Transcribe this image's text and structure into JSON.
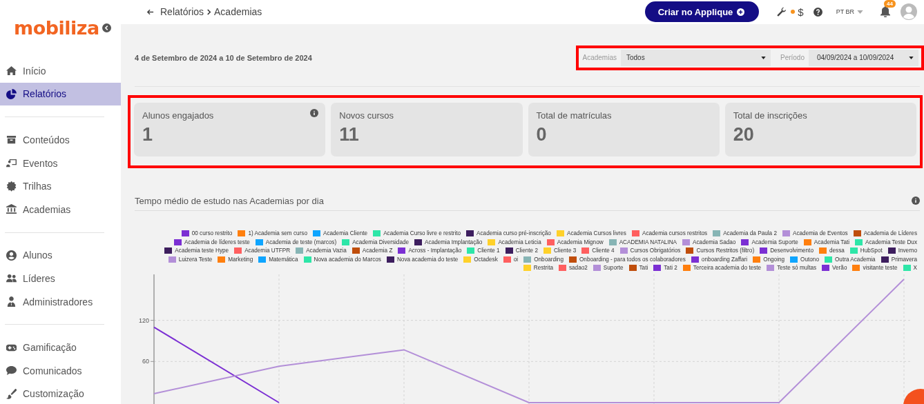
{
  "sidebar": {
    "logo": "mobiliza",
    "groups": [
      {
        "items": [
          {
            "label": "Início",
            "selected": false
          },
          {
            "label": "Relatórios",
            "selected": true
          }
        ]
      },
      {
        "items": [
          {
            "label": "Conteúdos",
            "selected": false
          },
          {
            "label": "Eventos",
            "selected": false
          },
          {
            "label": "Trilhas",
            "selected": false
          },
          {
            "label": "Academias",
            "selected": false
          }
        ]
      },
      {
        "items": [
          {
            "label": "Alunos",
            "selected": false
          },
          {
            "label": "Líderes",
            "selected": false
          },
          {
            "label": "Administradores",
            "selected": false
          }
        ]
      },
      {
        "items": [
          {
            "label": "Gamificação",
            "selected": false
          },
          {
            "label": "Comunicados",
            "selected": false
          },
          {
            "label": "Customização",
            "selected": false
          }
        ]
      }
    ]
  },
  "header": {
    "breadcrumb": [
      "Relatórios",
      "Academias"
    ],
    "create_button": "Criar no Applique",
    "currency": "$",
    "language": "PT BR",
    "notifications": "44"
  },
  "period_text": "4 de Setembro de 2024 a 10 de Setembro de 2024",
  "filters": [
    {
      "label": "Academias",
      "value": "Todos"
    },
    {
      "label": "Período",
      "value": "04/09/2024 a 10/09/2024"
    }
  ],
  "stats": [
    {
      "label": "Alunos engajados",
      "value": "1",
      "info": true
    },
    {
      "label": "Novos cursos",
      "value": "11",
      "info": false
    },
    {
      "label": "Total de matrículas",
      "value": "0",
      "info": false
    },
    {
      "label": "Total de inscrições",
      "value": "20",
      "info": false
    }
  ],
  "chart": {
    "title": "Tempo médio de estudo nas Academias por dia",
    "legend": [
      {
        "name": "00 curso restrito",
        "color": "#7b2fd3"
      },
      {
        "name": "1) Academia sem curso",
        "color": "#ff7f0e"
      },
      {
        "name": "Academia Cliente",
        "color": "#0ea5ff"
      },
      {
        "name": "Academia Curso livre e restrito",
        "color": "#2ee6a8"
      },
      {
        "name": "Academia curso pré-inscrição",
        "color": "#3d1e5e"
      },
      {
        "name": "Academia Cursos livres",
        "color": "#ffd12a"
      },
      {
        "name": "Academia cursos restritos",
        "color": "#ff5f5f"
      },
      {
        "name": "Academia da Paula 2",
        "color": "#87b5b5"
      },
      {
        "name": "Academia de Eventos",
        "color": "#b38fd8"
      },
      {
        "name": "Academia de Líderes",
        "color": "#c04e0c"
      },
      {
        "name": "Academia de líderes teste",
        "color": "#7b2fd3"
      },
      {
        "name": "Academia de teste (marcos)",
        "color": "#0ea5ff"
      },
      {
        "name": "Academia Diversidade",
        "color": "#2ee6a8"
      },
      {
        "name": "Academia Implantação",
        "color": "#3d1e5e"
      },
      {
        "name": "Academia Leticia",
        "color": "#ffd12a"
      },
      {
        "name": "Academia Mignow",
        "color": "#ff5f5f"
      },
      {
        "name": "ACADEMIA NATALINA",
        "color": "#87b5b5"
      },
      {
        "name": "Academia Sadao",
        "color": "#b38fd8"
      },
      {
        "name": "Academia Suporte",
        "color": "#7b2fd3"
      },
      {
        "name": "Academia Tati",
        "color": "#ff7f0e"
      },
      {
        "name": "Academia Teste Dux",
        "color": "#2ee6a8"
      },
      {
        "name": "Academia teste Hype",
        "color": "#3d1e5e"
      },
      {
        "name": "Academia UTFPR",
        "color": "#ff5f5f"
      },
      {
        "name": "Academia Vazia",
        "color": "#87b5b5"
      },
      {
        "name": "Academia Z",
        "color": "#c04e0c"
      },
      {
        "name": "Across - Implantação",
        "color": "#7b2fd3"
      },
      {
        "name": "Cliente 1",
        "color": "#2ee6a8"
      },
      {
        "name": "Cliente 2",
        "color": "#3d1e5e"
      },
      {
        "name": "Cliente 3",
        "color": "#ffd12a"
      },
      {
        "name": "Cliente 4",
        "color": "#ff5f5f"
      },
      {
        "name": "Cursos Obrigatórios",
        "color": "#b38fd8"
      },
      {
        "name": "Cursos Restritos (filtro)",
        "color": "#c04e0c"
      },
      {
        "name": "Desenvolvimento",
        "color": "#7b2fd3"
      },
      {
        "name": "dessa",
        "color": "#ff7f0e"
      },
      {
        "name": "HubSpot",
        "color": "#2ee6a8"
      },
      {
        "name": "Inverno",
        "color": "#3d1e5e"
      },
      {
        "name": "Luizera Teste",
        "color": "#b38fd8"
      },
      {
        "name": "Marketing",
        "color": "#ff7f0e"
      },
      {
        "name": "Matemática",
        "color": "#0ea5ff"
      },
      {
        "name": "Nova academia do Marcos",
        "color": "#2ee6a8"
      },
      {
        "name": "Nova academia do teste",
        "color": "#3d1e5e"
      },
      {
        "name": "Octadesk",
        "color": "#ffd12a"
      },
      {
        "name": "oi",
        "color": "#ff5f5f"
      },
      {
        "name": "Onboarding",
        "color": "#87b5b5"
      },
      {
        "name": "Onboarding - para todos os colaboradores",
        "color": "#c04e0c"
      },
      {
        "name": "onboarding Zaffari",
        "color": "#7b2fd3"
      },
      {
        "name": "Ongoing",
        "color": "#ff7f0e"
      },
      {
        "name": "Outono",
        "color": "#0ea5ff"
      },
      {
        "name": "Outra Academia",
        "color": "#2ee6a8"
      },
      {
        "name": "Primavera",
        "color": "#3d1e5e"
      },
      {
        "name": "Restrita",
        "color": "#ffd12a"
      },
      {
        "name": "sadao2",
        "color": "#ff5f5f"
      },
      {
        "name": "Suporte",
        "color": "#b38fd8"
      },
      {
        "name": "Tati",
        "color": "#c04e0c"
      },
      {
        "name": "Tati 2",
        "color": "#7b2fd3"
      },
      {
        "name": "Terceira academia do teste",
        "color": "#ff7f0e"
      },
      {
        "name": "Teste só multas",
        "color": "#b38fd8"
      },
      {
        "name": "Verão",
        "color": "#7b2fd3"
      },
      {
        "name": "visitante teste",
        "color": "#ff7f0e"
      },
      {
        "name": "X",
        "color": "#2ee6a8"
      }
    ],
    "chart_data": {
      "type": "line",
      "categories": [
        null,
        null,
        null,
        null,
        null,
        null,
        null
      ],
      "ylim": [
        0,
        187
      ],
      "yticks": [
        60,
        120
      ],
      "grid": true,
      "series": [
        {
          "color": "#7b2fd3",
          "values": [
            110,
            0,
            null,
            null,
            null,
            null,
            null
          ]
        },
        {
          "color": "#b38fd8",
          "values": [
            13,
            53,
            77,
            0,
            0,
            0,
            180
          ]
        }
      ]
    }
  }
}
